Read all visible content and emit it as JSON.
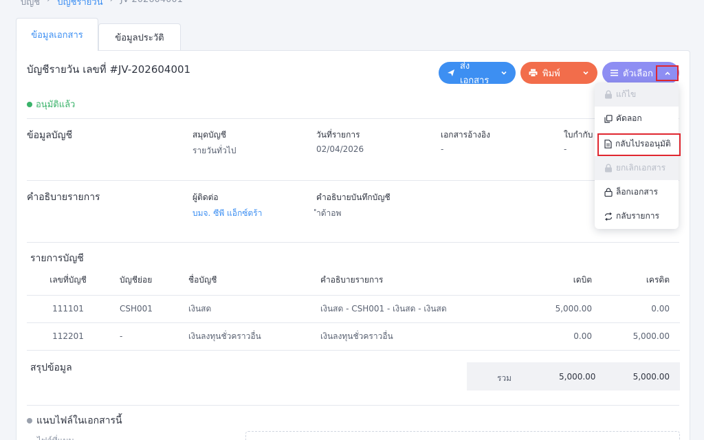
{
  "breadcrumb": [
    "บัญชี",
    "บัญชีรายวัน",
    "JV-202604001"
  ],
  "tabs": [
    {
      "label": "ข้อมูลเอกสาร",
      "active": true
    },
    {
      "label": "ข้อมูลประวัติ",
      "active": false
    }
  ],
  "document": {
    "title": "บัญชีรายวัน เลขที่ #JV-202604001",
    "status": "อนุมัติแล้ว"
  },
  "actions": {
    "send": "ส่งเอกสาร",
    "print": "พิมพ์",
    "options": "ตัวเลือก"
  },
  "options_menu": [
    {
      "label": "แก้ไข",
      "icon": "lock-icon",
      "enabled": false
    },
    {
      "label": "คัดลอก",
      "icon": "copy-icon",
      "enabled": true
    },
    {
      "label": "กลับไปรออนุมัติ",
      "icon": "document-icon",
      "enabled": true
    },
    {
      "label": "ยกเลิกเอกสาร",
      "icon": "lock-icon",
      "enabled": false
    },
    {
      "label": "ล็อกเอกสาร",
      "icon": "padlock-outline-icon",
      "enabled": true
    },
    {
      "label": "กลับรายการ",
      "icon": "reverse-icon",
      "enabled": true
    }
  ],
  "account_info": {
    "section": "ข้อมูลบัญชี",
    "journal_label": "สมุดบัญชี",
    "journal_value": "รายวันทั่วไป",
    "date_label": "วันที่รายการ",
    "date_value": "02/04/2026",
    "ref_label": "เอกสารอ้างอิง",
    "ref_value": "-",
    "tax_label": "ใบกำกับ",
    "tax_value": "-"
  },
  "description": {
    "section": "คำอธิบายรายการ",
    "contact_label": "ผู้ติดต่อ",
    "contact_value": "บมจ. ซีพี แอ็กซ์ตร้า",
    "note_label": "คำอธิบายบันทึกบัญชี",
    "note_value": "ำด้าอพ"
  },
  "ledger": {
    "title": "รายการบัญชี",
    "columns": [
      "เลขที่บัญชี",
      "บัญชีย่อย",
      "ชื่อบัญชี",
      "คำอธิบายรายการ",
      "เดบิต",
      "เครดิต"
    ],
    "rows": [
      {
        "no": "111101",
        "sub": "CSH001",
        "name": "เงินสด",
        "desc": "เงินสด - CSH001 - เงินสด - เงินสด",
        "debit": "5,000.00",
        "credit": "0.00"
      },
      {
        "no": "112201",
        "sub": "-",
        "name": "เงินลงทุนชั่วคราวอื่น",
        "desc": "เงินลงทุนชั่วคราวอื่น",
        "debit": "0.00",
        "credit": "5,000.00"
      }
    ]
  },
  "summary": {
    "title": "สรุปข้อมูล",
    "total_label": "รวม",
    "total_debit": "5,000.00",
    "total_credit": "5,000.00"
  },
  "attachments": {
    "title": "แนบไฟล์ในเอกสารนี้",
    "hint": "ไฟล์ที่แนบ..."
  },
  "colors": {
    "primary": "#3d8ff2",
    "print": "#f26d4b",
    "options": "#8e8ef3",
    "approved": "#3ab36a",
    "highlight": "#e0262f"
  }
}
